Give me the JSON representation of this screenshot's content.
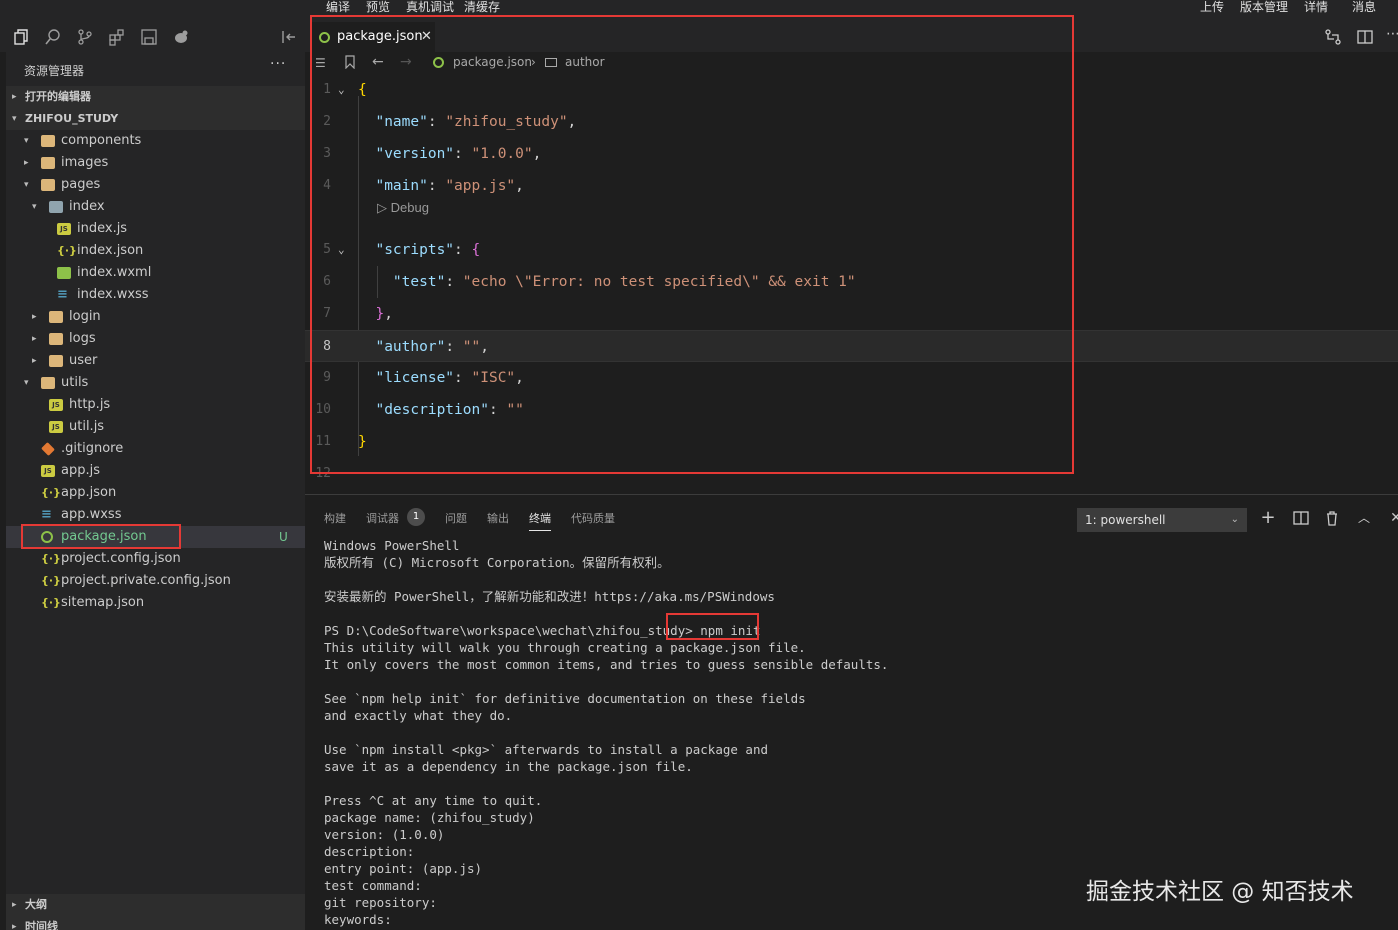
{
  "topbar": {
    "left": [
      "编译",
      "预览",
      "真机调试",
      "清缓存"
    ],
    "right": [
      "上传",
      "版本管理",
      "详情",
      "消息"
    ]
  },
  "activity_icons": [
    "files-icon",
    "search-icon",
    "source-control-icon",
    "extensions-icon",
    "save-icon",
    "debug-icon"
  ],
  "sidebar": {
    "title": "资源管理器",
    "more": "···",
    "open_editors": "打开的编辑器",
    "project": "ZHIFOU_STUDY",
    "outline": "大纲",
    "timeline": "时间线",
    "tree": [
      {
        "label": "components",
        "type": "folder",
        "depth": 1,
        "expanded": true
      },
      {
        "label": "images",
        "type": "folder",
        "depth": 1,
        "expanded": false
      },
      {
        "label": "pages",
        "type": "folder",
        "depth": 1,
        "expanded": true
      },
      {
        "label": "index",
        "type": "folder-open",
        "depth": 2,
        "expanded": true
      },
      {
        "label": "index.js",
        "type": "js",
        "depth": 3
      },
      {
        "label": "index.json",
        "type": "json",
        "depth": 3
      },
      {
        "label": "index.wxml",
        "type": "wxml",
        "depth": 3
      },
      {
        "label": "index.wxss",
        "type": "wxss",
        "depth": 3
      },
      {
        "label": "login",
        "type": "folder",
        "depth": 2,
        "expanded": false
      },
      {
        "label": "logs",
        "type": "folder",
        "depth": 2,
        "expanded": false
      },
      {
        "label": "user",
        "type": "folder",
        "depth": 2,
        "expanded": false
      },
      {
        "label": "utils",
        "type": "folder",
        "depth": 1,
        "expanded": true
      },
      {
        "label": "http.js",
        "type": "js",
        "depth": 2
      },
      {
        "label": "util.js",
        "type": "js",
        "depth": 2
      },
      {
        "label": ".gitignore",
        "type": "git",
        "depth": 1
      },
      {
        "label": "app.js",
        "type": "js",
        "depth": 1
      },
      {
        "label": "app.json",
        "type": "json",
        "depth": 1
      },
      {
        "label": "app.wxss",
        "type": "wxss",
        "depth": 1
      },
      {
        "label": "package.json",
        "type": "pkg",
        "depth": 1,
        "selected": true,
        "badge": "U"
      },
      {
        "label": "project.config.json",
        "type": "json",
        "depth": 1
      },
      {
        "label": "project.private.config.json",
        "type": "json",
        "depth": 1
      },
      {
        "label": "sitemap.json",
        "type": "json",
        "depth": 1
      }
    ]
  },
  "editor": {
    "tab_label": "package.json",
    "tab_close": "✕",
    "breadcrumb": [
      "package.json",
      "author"
    ],
    "codelens": "▷ Debug",
    "lines": [
      {
        "n": "1",
        "tokens": [
          [
            "b",
            "{"
          ]
        ]
      },
      {
        "n": "2",
        "tokens": [
          [
            "p",
            "  "
          ],
          [
            "k",
            "\"name\""
          ],
          [
            "p",
            ": "
          ],
          [
            "s",
            "\"zhifou_study\""
          ],
          [
            "p",
            ","
          ]
        ]
      },
      {
        "n": "3",
        "tokens": [
          [
            "p",
            "  "
          ],
          [
            "k",
            "\"version\""
          ],
          [
            "p",
            ": "
          ],
          [
            "s",
            "\"1.0.0\""
          ],
          [
            "p",
            ","
          ]
        ]
      },
      {
        "n": "4",
        "tokens": [
          [
            "p",
            "  "
          ],
          [
            "k",
            "\"main\""
          ],
          [
            "p",
            ": "
          ],
          [
            "s",
            "\"app.js\""
          ],
          [
            "p",
            ","
          ]
        ]
      },
      {
        "n": "5",
        "tokens": [
          [
            "p",
            "  "
          ],
          [
            "k",
            "\"scripts\""
          ],
          [
            "p",
            ": "
          ],
          [
            "bm",
            "{"
          ]
        ]
      },
      {
        "n": "6",
        "tokens": [
          [
            "p",
            "    "
          ],
          [
            "k",
            "\"test\""
          ],
          [
            "p",
            ": "
          ],
          [
            "s",
            "\"echo \\\"Error: no test specified\\\" && exit 1\""
          ]
        ]
      },
      {
        "n": "7",
        "tokens": [
          [
            "p",
            "  "
          ],
          [
            "bm",
            "}"
          ],
          [
            "p",
            ","
          ]
        ]
      },
      {
        "n": "8",
        "tokens": [
          [
            "p",
            "  "
          ],
          [
            "k",
            "\"author\""
          ],
          [
            "p",
            ": "
          ],
          [
            "s",
            "\"\""
          ],
          [
            "p",
            ","
          ]
        ]
      },
      {
        "n": "9",
        "tokens": [
          [
            "p",
            "  "
          ],
          [
            "k",
            "\"license\""
          ],
          [
            "p",
            ": "
          ],
          [
            "s",
            "\"ISC\""
          ],
          [
            "p",
            ","
          ]
        ]
      },
      {
        "n": "10",
        "tokens": [
          [
            "p",
            "  "
          ],
          [
            "k",
            "\"description\""
          ],
          [
            "p",
            ": "
          ],
          [
            "s",
            "\"\""
          ]
        ]
      },
      {
        "n": "11",
        "tokens": [
          [
            "b",
            "}"
          ]
        ]
      },
      {
        "n": "12",
        "tokens": []
      }
    ]
  },
  "panel": {
    "tabs": [
      "构建",
      "调试器",
      "问题",
      "输出",
      "终端",
      "代码质量"
    ],
    "debug_badge": "1",
    "active_tab": "终端",
    "terminal_select": "1: powershell",
    "terminal_lines": [
      "Windows PowerShell",
      "版权所有 (C) Microsoft Corporation。保留所有权利。",
      "",
      "安装最新的 PowerShell，了解新功能和改进！https://aka.ms/PSWindows",
      "",
      "PS D:\\CodeSoftware\\workspace\\wechat\\zhifou_study> npm init",
      "This utility will walk you through creating a package.json file.",
      "It only covers the most common items, and tries to guess sensible defaults.",
      "",
      "See `npm help init` for definitive documentation on these fields",
      "and exactly what they do.",
      "",
      "Use `npm install <pkg>` afterwards to install a package and",
      "save it as a dependency in the package.json file.",
      "",
      "Press ^C at any time to quit.",
      "package name: (zhifou_study)",
      "version: (1.0.0)",
      "description:",
      "entry point: (app.js)",
      "test command:",
      "git repository:",
      "keywords:"
    ]
  },
  "watermark": "掘金技术社区 @ 知否技术",
  "colors": {
    "highlight": "#e53935",
    "accent": "#73c991"
  }
}
